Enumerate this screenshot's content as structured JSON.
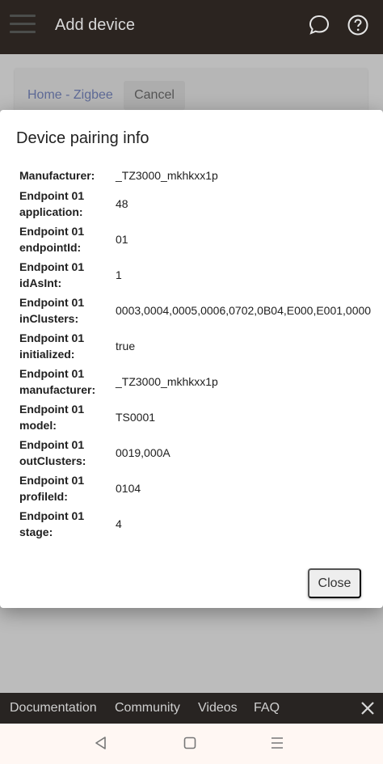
{
  "appbar": {
    "title": "Add device",
    "menu_icon": "hamburger-icon",
    "chat_icon": "chat-bubble-icon",
    "help_icon": "help-circle-icon"
  },
  "background": {
    "breadcrumb": "Home - Zigbee",
    "cancel_label": "Cancel"
  },
  "dialog": {
    "title": "Device pairing info",
    "rows": [
      {
        "key": "Manufacturer:",
        "value": "_TZ3000_mkhkxx1p"
      },
      {
        "key": "Endpoint 01 application:",
        "value": "48"
      },
      {
        "key": "Endpoint 01 endpointId:",
        "value": "01"
      },
      {
        "key": "Endpoint 01 idAsInt:",
        "value": "1"
      },
      {
        "key": "Endpoint 01 inClusters:",
        "value": "0003,0004,0005,0006,0702,0B04,E000,E001,0000"
      },
      {
        "key": "Endpoint 01 initialized:",
        "value": "true"
      },
      {
        "key": "Endpoint 01 manufacturer:",
        "value": "_TZ3000_mkhkxx1p"
      },
      {
        "key": "Endpoint 01 model:",
        "value": "TS0001"
      },
      {
        "key": "Endpoint 01 outClusters:",
        "value": "0019,000A"
      },
      {
        "key": "Endpoint 01 profileId:",
        "value": "0104"
      },
      {
        "key": "Endpoint 01 stage:",
        "value": "4"
      }
    ],
    "close_label": "Close"
  },
  "footer": {
    "links": [
      "Documentation",
      "Community",
      "Videos",
      "FAQ"
    ],
    "close_icon": "close-icon"
  },
  "system_nav": {
    "back_icon": "back-triangle-icon",
    "home_icon": "home-square-icon",
    "recents_icon": "recents-menu-icon"
  },
  "colors": {
    "appbar": "#2b2420",
    "link": "#5e6a96",
    "footer": "#282422"
  }
}
